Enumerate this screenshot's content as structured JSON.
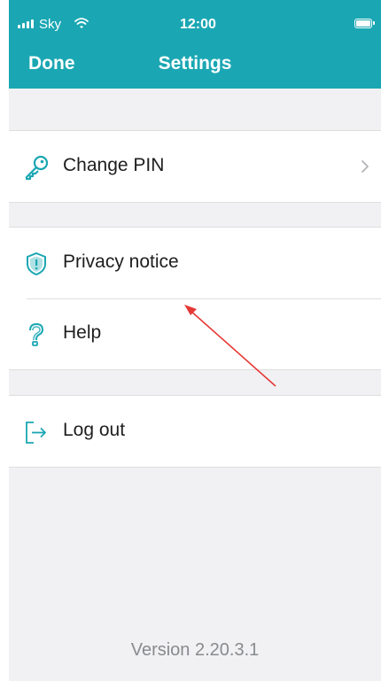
{
  "status_bar": {
    "carrier": "Sky",
    "time": "12:00"
  },
  "nav": {
    "done_label": "Done",
    "title": "Settings"
  },
  "settings": {
    "change_pin": {
      "label": "Change PIN",
      "icon": "key-icon"
    },
    "privacy_notice": {
      "label": "Privacy notice",
      "icon": "shield-icon"
    },
    "help": {
      "label": "Help",
      "icon": "question-mark-icon"
    },
    "log_out": {
      "label": "Log out",
      "icon": "log-out-icon"
    }
  },
  "footer": {
    "version": "Version 2.20.3.1"
  },
  "colors": {
    "header": "#1aa7b3",
    "icon": "#1aa7b3",
    "annotation_arrow": "#e53935"
  }
}
